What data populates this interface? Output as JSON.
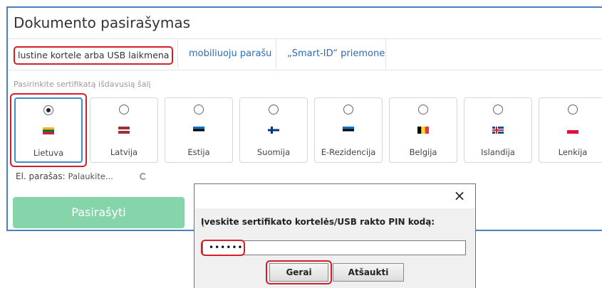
{
  "title": "Dokumento pasirašymas",
  "tabs": [
    {
      "label": "lustine kortele arba USB laikmena"
    },
    {
      "label": "mobiliuoju parašu"
    },
    {
      "label": "„Smart-ID“ priemone"
    }
  ],
  "country_prompt": "Pasirinkite sertifikatą išdavusią šalį",
  "countries": [
    {
      "name": "Lietuva",
      "selected": true,
      "flag": "lithuania-flag-icon"
    },
    {
      "name": "Latvija",
      "selected": false,
      "flag": "latvia-flag-icon"
    },
    {
      "name": "Estija",
      "selected": false,
      "flag": "estonia-flag-icon"
    },
    {
      "name": "Suomija",
      "selected": false,
      "flag": "finland-flag-icon"
    },
    {
      "name": "E-Rezidencija",
      "selected": false,
      "flag": "estonia-flag-icon"
    },
    {
      "name": "Belgija",
      "selected": false,
      "flag": "belgium-flag-icon"
    },
    {
      "name": "Islandija",
      "selected": false,
      "flag": "iceland-flag-icon"
    },
    {
      "name": "Lenkija",
      "selected": false,
      "flag": "poland-flag-icon"
    }
  ],
  "signature": {
    "label": "El. parašas:",
    "status": "Palaukite..."
  },
  "sign_button": "Pasirašyti",
  "dialog": {
    "close": "×",
    "prompt": "Įveskite sertifikato kortelės/USB rakto PIN kodą:",
    "pin_value": "••••••",
    "ok": "Gerai",
    "cancel": "Atšaukti"
  },
  "colors": {
    "accent": "#2b6cb8",
    "highlight": "#d41f2a",
    "sign_button": "#86d4aa",
    "selected_border": "#3b8fc4"
  }
}
